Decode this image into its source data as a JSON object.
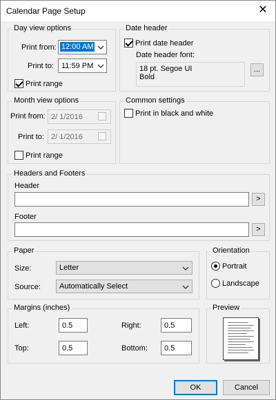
{
  "window": {
    "title": "Calendar Page Setup",
    "close_glyph": "✕"
  },
  "day_view": {
    "legend": "Day view options",
    "print_from_label": "Print from:",
    "print_from_value": "12:00 AM",
    "print_to_label": "Print to:",
    "print_to_value": "11:59 PM",
    "print_range_label": "Print range",
    "print_range_checked": true
  },
  "date_header": {
    "legend": "Date header",
    "print_date_header_label": "Print date header",
    "print_date_header_checked": true,
    "font_label": "Date header font:",
    "font_line1": "18 pt. Segoe UI",
    "font_line2": "Bold",
    "font_button": "..."
  },
  "month_view": {
    "legend": "Month view options",
    "print_from_label": "Print from:",
    "print_from_value": "2/ 1/2016",
    "print_to_label": "Print to:",
    "print_to_value": "2/ 1/2016",
    "print_range_label": "Print range",
    "print_range_checked": false
  },
  "common": {
    "legend": "Common settings",
    "black_white_label": "Print in black and white",
    "black_white_checked": false
  },
  "headers_footers": {
    "legend": "Headers and Footers",
    "header_label": "Header",
    "header_value": "",
    "header_button": ">",
    "footer_label": "Footer",
    "footer_value": "",
    "footer_button": ">"
  },
  "paper": {
    "legend": "Paper",
    "size_label": "Size:",
    "size_value": "Letter",
    "source_label": "Source:",
    "source_value": "Automatically Select"
  },
  "orientation": {
    "legend": "Orientation",
    "portrait_label": "Portrait",
    "landscape_label": "Landscape",
    "selected": "portrait"
  },
  "margins": {
    "legend": "Margins (inches)",
    "left_label": "Left:",
    "left_value": "0.5",
    "right_label": "Right:",
    "right_value": "0.5",
    "top_label": "Top:",
    "top_value": "0.5",
    "bottom_label": "Bottom:",
    "bottom_value": "0.5"
  },
  "preview": {
    "legend": "Preview"
  },
  "buttons": {
    "ok": "OK",
    "cancel": "Cancel"
  },
  "colors": {
    "accent": "#0078d7",
    "dialog_bg": "#f0f0f0",
    "group_border": "#d5d5d5"
  }
}
